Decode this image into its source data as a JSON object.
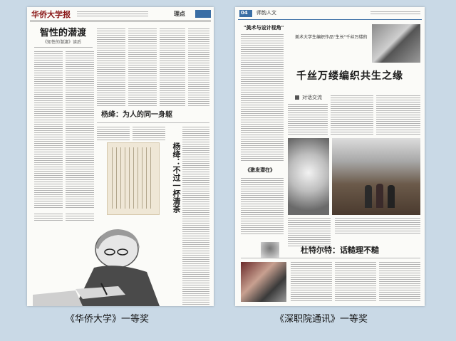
{
  "left_paper": {
    "masthead": "华侨大学报",
    "section": "理点",
    "headline": "智性的潜渡",
    "subhead": "《知性的潜渡》读后",
    "feature_title": "杨绛：为人的同一身躯",
    "column_headline": "杨绛：不过一杯清茶",
    "award_caption": "《华侨大学》一等奖"
  },
  "right_paper": {
    "page_number": "04",
    "section": "师韵人文",
    "kicker": "美术大学生编织作品\"生长\"千丝万缕的",
    "headline": "千丝万缕编织共生之缘",
    "sub_section": "对话交流",
    "side_headline_1": "\"美术与设计视角\"",
    "side_headline_2": "《激发潜在》",
    "column_headline": "杜特尔特：话糙理不糙",
    "award_caption": "《深职院通讯》一等奖"
  },
  "colors": {
    "background": "#c9d9e6",
    "paper": "#fbfbf8",
    "section_tab": "#3a6ea5",
    "masthead_red": "#8b1a1a"
  }
}
